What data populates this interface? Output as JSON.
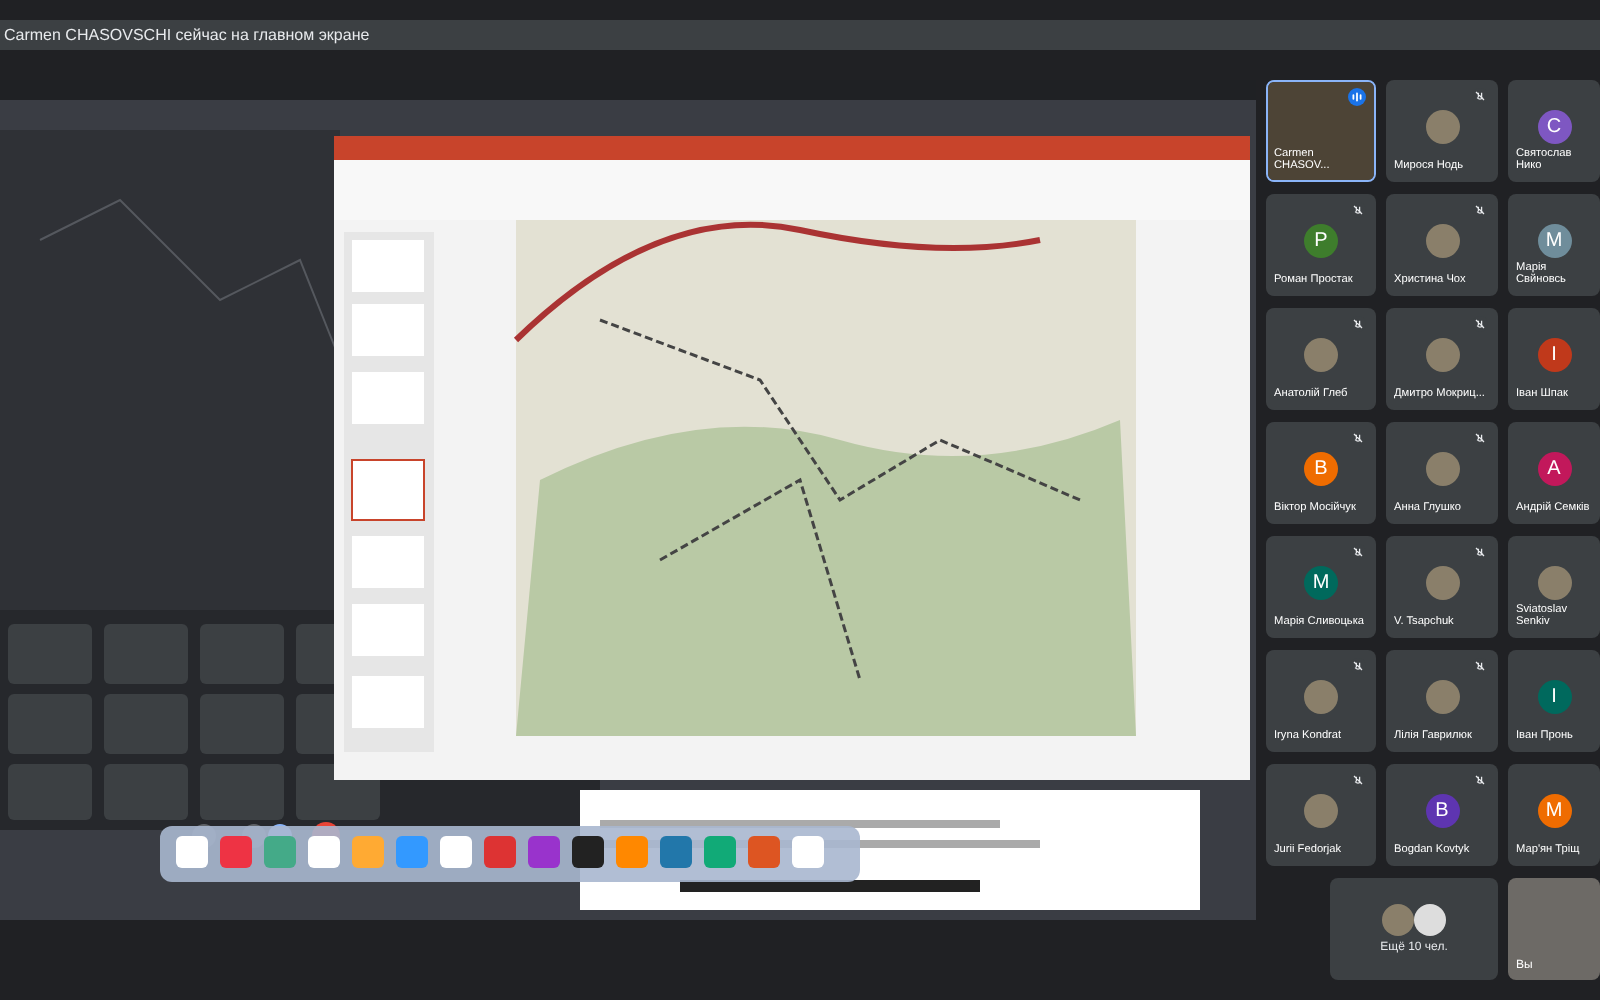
{
  "banner": {
    "text": "Carmen CHASOVSCHI сейчас на главном экране"
  },
  "participants": [
    {
      "name": "Carmen CHASOV...",
      "kind": "video",
      "muted": false,
      "speaking": true
    },
    {
      "name": "Мирося Нодь",
      "kind": "photo",
      "muted": true,
      "speaking": false
    },
    {
      "name": "Святослав Нико",
      "kind": "letter",
      "letter": "C",
      "color": "#7e57c2",
      "muted": false,
      "speaking": false
    },
    {
      "name": "Роман Простак",
      "kind": "letter",
      "letter": "P",
      "color": "#3e7d2c",
      "muted": true,
      "speaking": false
    },
    {
      "name": "Христина Чох",
      "kind": "photo",
      "muted": true,
      "speaking": false
    },
    {
      "name": "Марія Свйновсь",
      "kind": "letter",
      "letter": "M",
      "color": "#6f8d9b",
      "muted": false,
      "speaking": false
    },
    {
      "name": "Анатолій Глеб",
      "kind": "photo",
      "muted": true,
      "speaking": false
    },
    {
      "name": "Дмитро Мокриц...",
      "kind": "photo",
      "muted": true,
      "speaking": false
    },
    {
      "name": "Іван Шпак",
      "kind": "letter",
      "letter": "I",
      "color": "#c0391b",
      "muted": false,
      "speaking": false
    },
    {
      "name": "Віктор Мосійчук",
      "kind": "letter",
      "letter": "B",
      "color": "#ef6c00",
      "muted": true,
      "speaking": false
    },
    {
      "name": "Анна Глушко",
      "kind": "photo",
      "muted": true,
      "speaking": false
    },
    {
      "name": "Андрій Семків",
      "kind": "letter",
      "letter": "A",
      "color": "#c2185b",
      "muted": false,
      "speaking": false
    },
    {
      "name": "Марія Сливоцька",
      "kind": "letter",
      "letter": "M",
      "color": "#00695c",
      "muted": true,
      "speaking": false
    },
    {
      "name": "V. Tsapchuk",
      "kind": "photo",
      "muted": true,
      "speaking": false
    },
    {
      "name": "Sviatoslav Senkiv",
      "kind": "photo",
      "muted": false,
      "speaking": false
    },
    {
      "name": "Iryna Kondrat",
      "kind": "photo",
      "muted": true,
      "speaking": false
    },
    {
      "name": "Лілія Гаврилюк",
      "kind": "photo",
      "muted": true,
      "speaking": false
    },
    {
      "name": "Іван Пронь",
      "kind": "letter",
      "letter": "I",
      "color": "#00695d",
      "muted": false,
      "speaking": false
    },
    {
      "name": "Jurii Fedorjak",
      "kind": "photo",
      "muted": true,
      "speaking": false
    },
    {
      "name": "Bogdan Kovtyk",
      "kind": "letter",
      "letter": "B",
      "color": "#5e35b1",
      "muted": true,
      "speaking": false
    },
    {
      "name": "Мар'ян Тріщ",
      "kind": "letter",
      "letter": "M",
      "color": "#ef6c01",
      "muted": false,
      "speaking": false
    }
  ],
  "more": {
    "label": "Ещё 10 чел."
  },
  "self": {
    "label": "Вы"
  }
}
